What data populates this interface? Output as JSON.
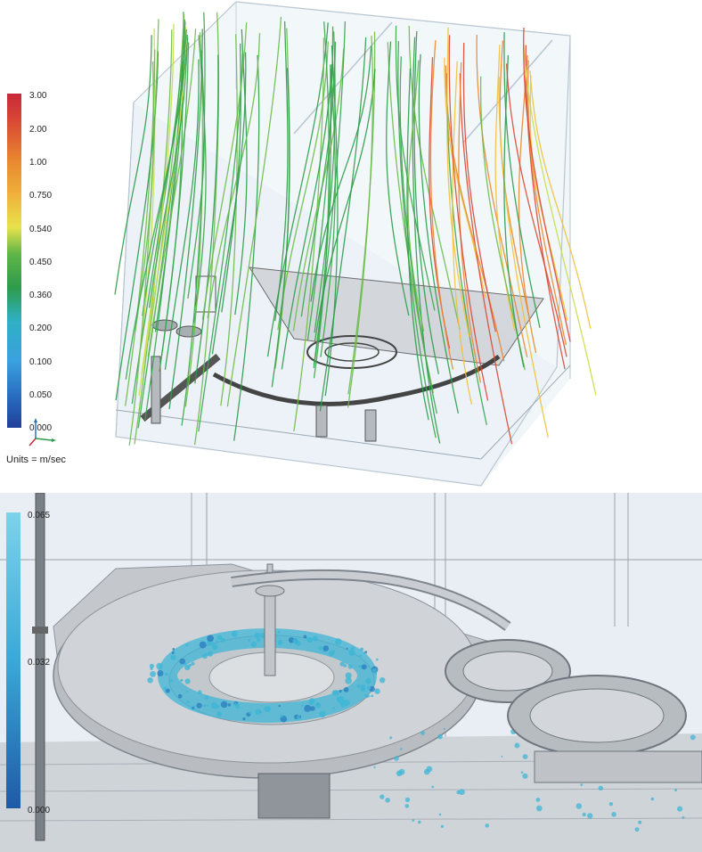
{
  "top": {
    "legend": {
      "ticks": [
        "3.00",
        "2.00",
        "1.00",
        "0.750",
        "0.540",
        "0.450",
        "0.360",
        "0.200",
        "0.100",
        "0.050",
        "0.000"
      ],
      "colors": [
        "#c8283a",
        "#d94735",
        "#e8872f",
        "#efb03c",
        "#e8e24a",
        "#5fb548",
        "#2e9b4a",
        "#2fb0c4",
        "#3aa1df",
        "#2a6fc2",
        "#1f4fa8"
      ],
      "units": "Units = m/sec"
    },
    "streamline_colors": [
      "#2e9b4a",
      "#3aa54b",
      "#6dbb4a",
      "#c9dd4a",
      "#f0c03a",
      "#e8872f",
      "#d94735"
    ]
  },
  "bottom": {
    "legend": {
      "ticks": [
        "0.065",
        "0.032",
        "0.000"
      ],
      "colors": [
        "#7cd3ea",
        "#38a9d9",
        "#1e5aa8"
      ]
    },
    "fluid_color": "#3fb6d6",
    "machine_color": "#bfc3c8"
  }
}
